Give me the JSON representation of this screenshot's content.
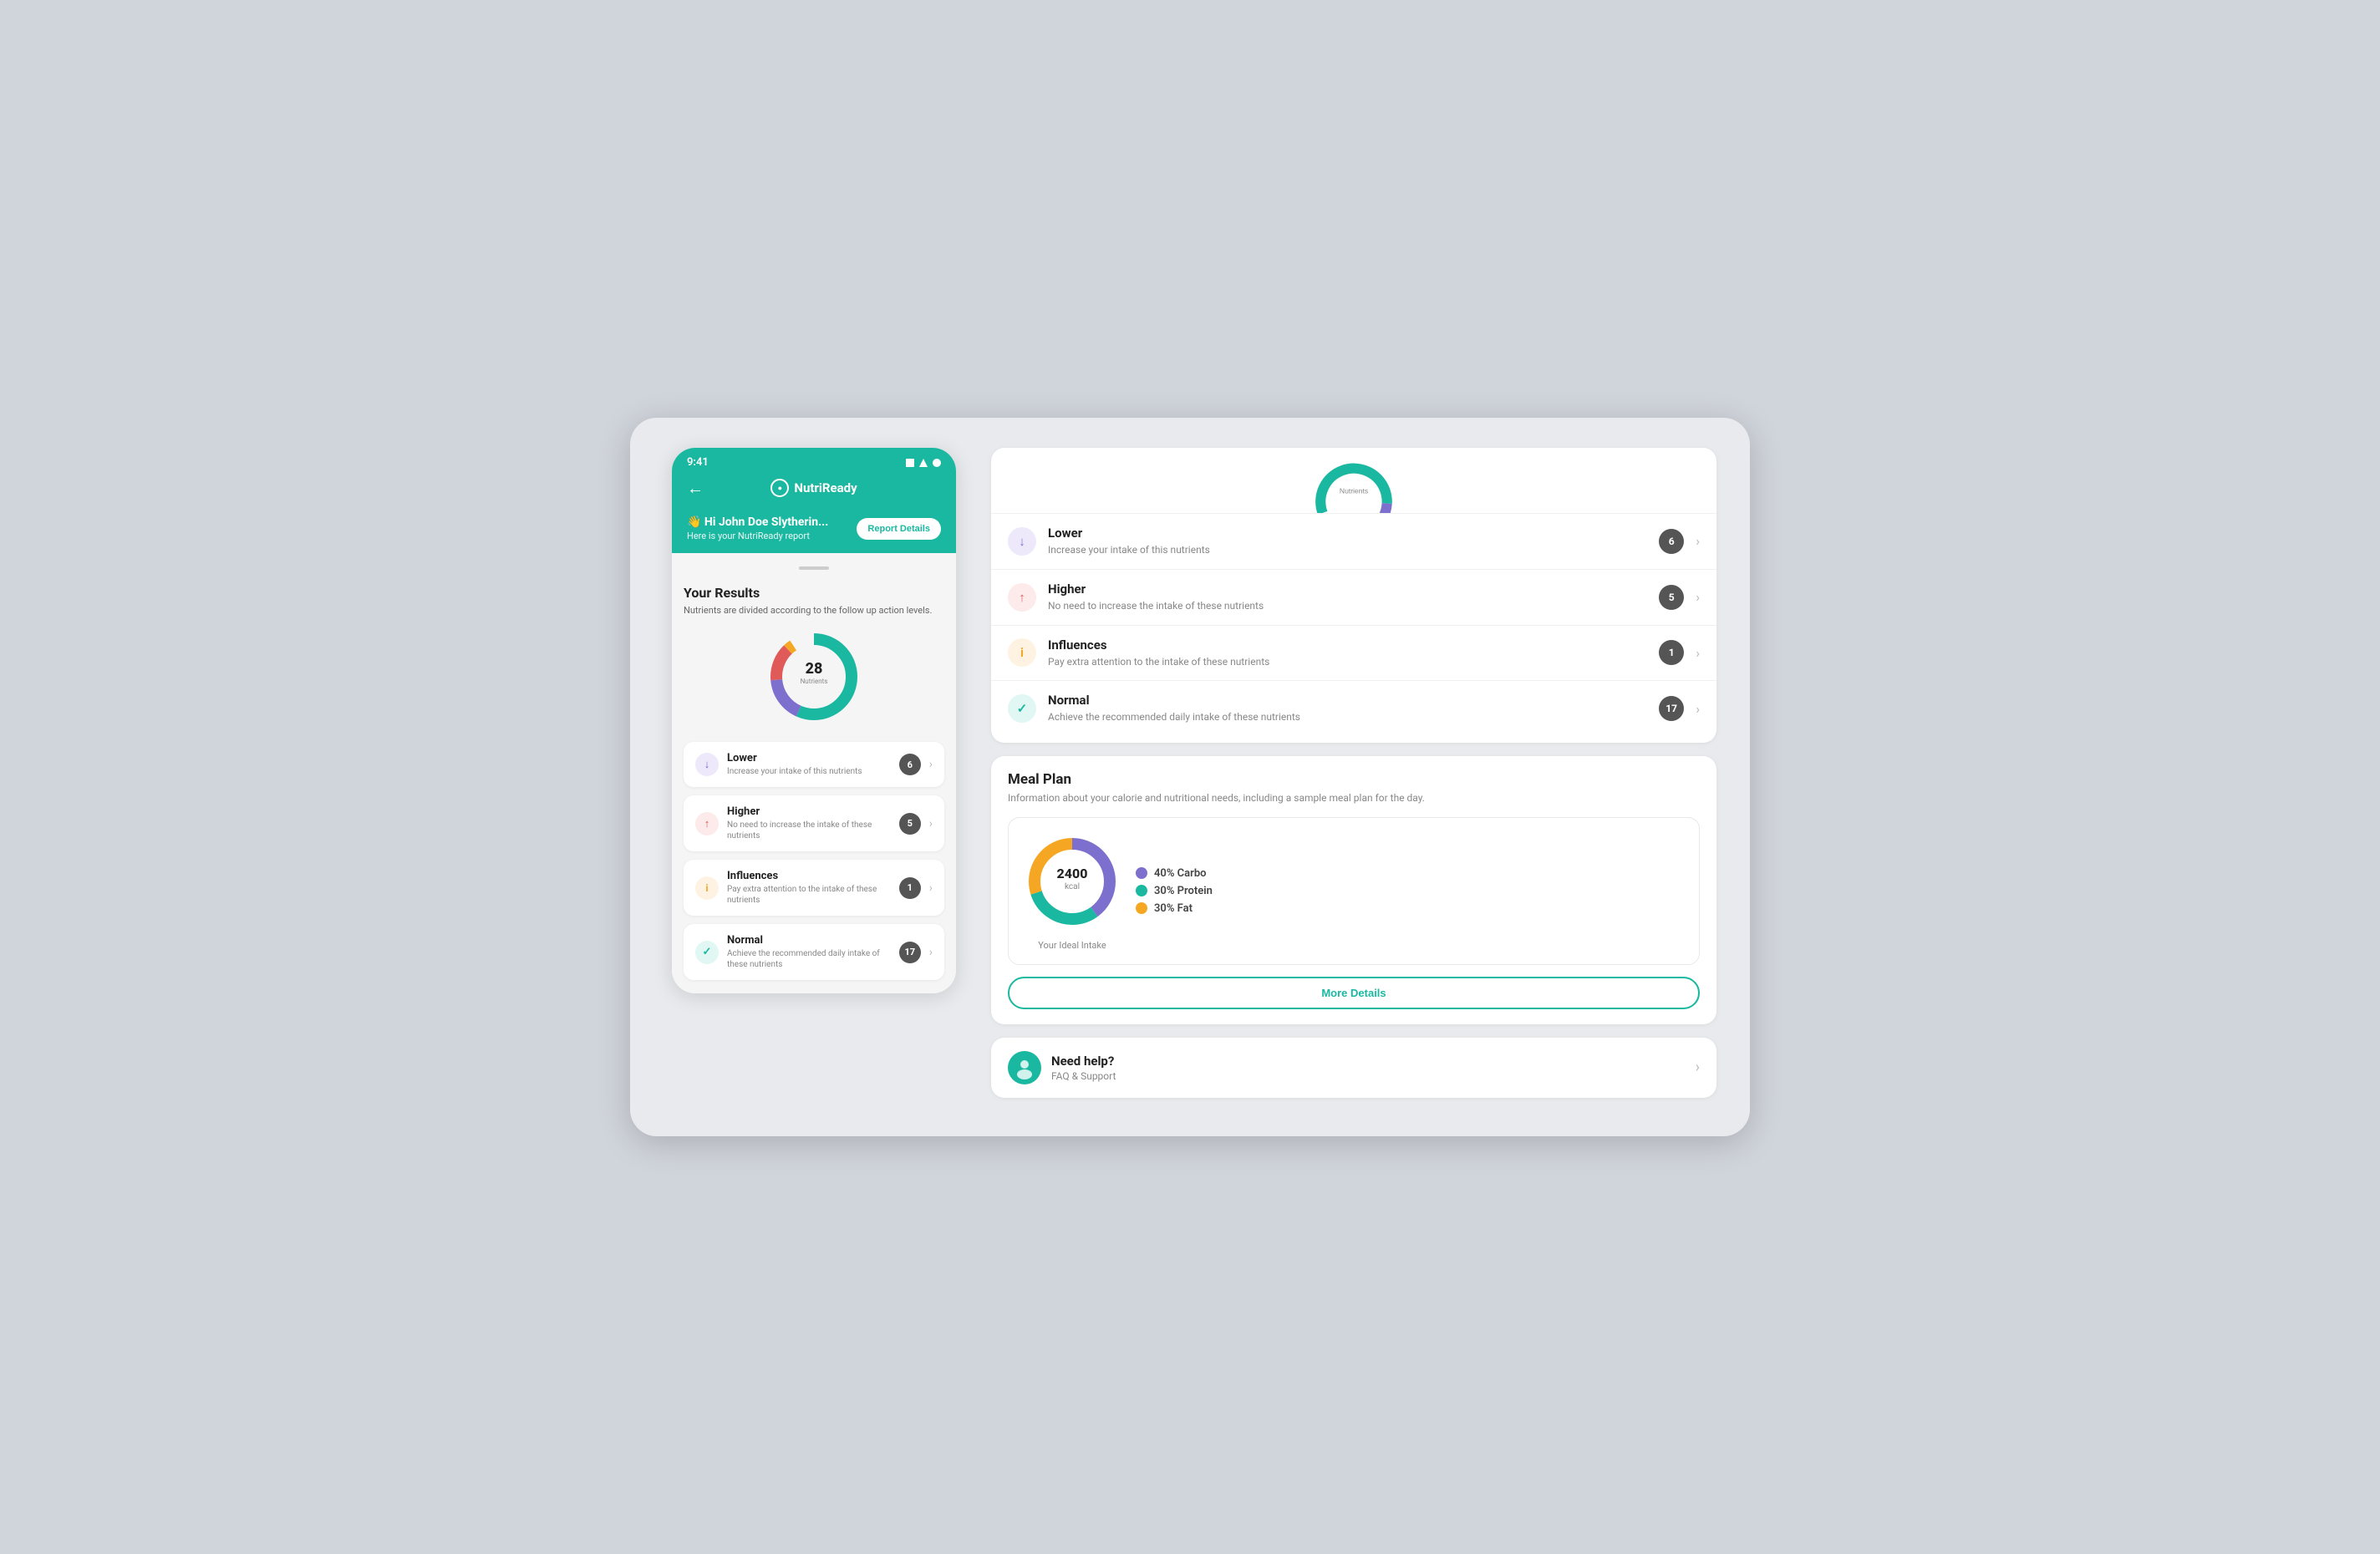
{
  "app": {
    "name": "NutriReady"
  },
  "phone": {
    "time": "9:41",
    "greeting": "👋 Hi John Doe Slytherin...",
    "greeting_sub": "Here is your NutriReady report",
    "report_btn": "Report Details",
    "results_title": "Your Results",
    "results_subtitle": "Nutrients are divided according to the follow up action levels.",
    "donut": {
      "center_value": "28",
      "center_label": "Nutrients"
    },
    "nutrient_items": [
      {
        "id": "lower",
        "title": "Lower",
        "desc": "Increase your intake of this nutrients",
        "count": "6",
        "icon_color": "#7c6fcd",
        "icon_symbol": "↓",
        "badge_color": "#555"
      },
      {
        "id": "higher",
        "title": "Higher",
        "desc": "No need to increase the intake of these nutrients",
        "count": "5",
        "icon_color": "#e05a5a",
        "icon_symbol": "↑",
        "badge_color": "#555"
      },
      {
        "id": "influences",
        "title": "Influences",
        "desc": "Pay extra attention to the intake of these nutrients",
        "count": "1",
        "icon_color": "#f5a623",
        "icon_symbol": "i",
        "badge_color": "#555"
      },
      {
        "id": "normal",
        "title": "Normal",
        "desc": "Achieve the recommended daily intake of these nutrients",
        "count": "17",
        "icon_color": "#1ab8a0",
        "icon_symbol": "✓",
        "badge_color": "#555"
      }
    ]
  },
  "right_panel": {
    "nutrient_items": [
      {
        "id": "lower",
        "title": "Lower",
        "desc": "Increase your intake of this nutrients",
        "count": "6",
        "icon_color": "#7c6fcd",
        "icon_symbol": "↓",
        "badge_color": "#555"
      },
      {
        "id": "higher",
        "title": "Higher",
        "desc": "No need to increase the intake of these nutrients",
        "count": "5",
        "icon_color": "#e05a5a",
        "icon_symbol": "↑",
        "badge_color": "#555"
      },
      {
        "id": "influences",
        "title": "Influences",
        "desc": "Pay extra attention to the intake of these nutrients",
        "count": "1",
        "icon_color": "#f5a623",
        "icon_symbol": "i",
        "badge_color": "#555"
      },
      {
        "id": "normal",
        "title": "Normal",
        "desc": "Achieve the recommended daily intake of these nutrients",
        "count": "17",
        "icon_color": "#1ab8a0",
        "icon_symbol": "✓",
        "badge_color": "#555"
      }
    ],
    "meal_plan": {
      "title": "Meal Plan",
      "subtitle": "Information about your calorie and nutritional needs, including a sample meal plan for the day.",
      "kcal": "2400",
      "kcal_label": "kcal",
      "ideal_intake_label": "Your Ideal Intake",
      "more_details_btn": "More Details",
      "macros": [
        {
          "label": "40% Carbo",
          "color": "#7c6fcd"
        },
        {
          "label": "30% Protein",
          "color": "#1ab8a0"
        },
        {
          "label": "30% Fat",
          "color": "#f5a623"
        }
      ]
    },
    "help": {
      "title": "Need help?",
      "subtitle": "FAQ & Support"
    }
  },
  "donut_segments": {
    "phone": [
      {
        "label": "Lower",
        "color": "#7c6fcd",
        "value": 6
      },
      {
        "label": "Higher",
        "color": "#e05a5a",
        "value": 5
      },
      {
        "label": "Influences",
        "color": "#f5a623",
        "value": 1
      },
      {
        "label": "Normal",
        "color": "#1ab8a0",
        "value": 16
      }
    ],
    "right_top": [
      {
        "label": "Lower",
        "color": "#7c6fcd",
        "value": 6
      },
      {
        "label": "Higher",
        "color": "#e05a5a",
        "value": 5
      },
      {
        "label": "Influences",
        "color": "#f5a623",
        "value": 1
      },
      {
        "label": "Normal",
        "color": "#1ab8a0",
        "value": 16
      }
    ]
  }
}
